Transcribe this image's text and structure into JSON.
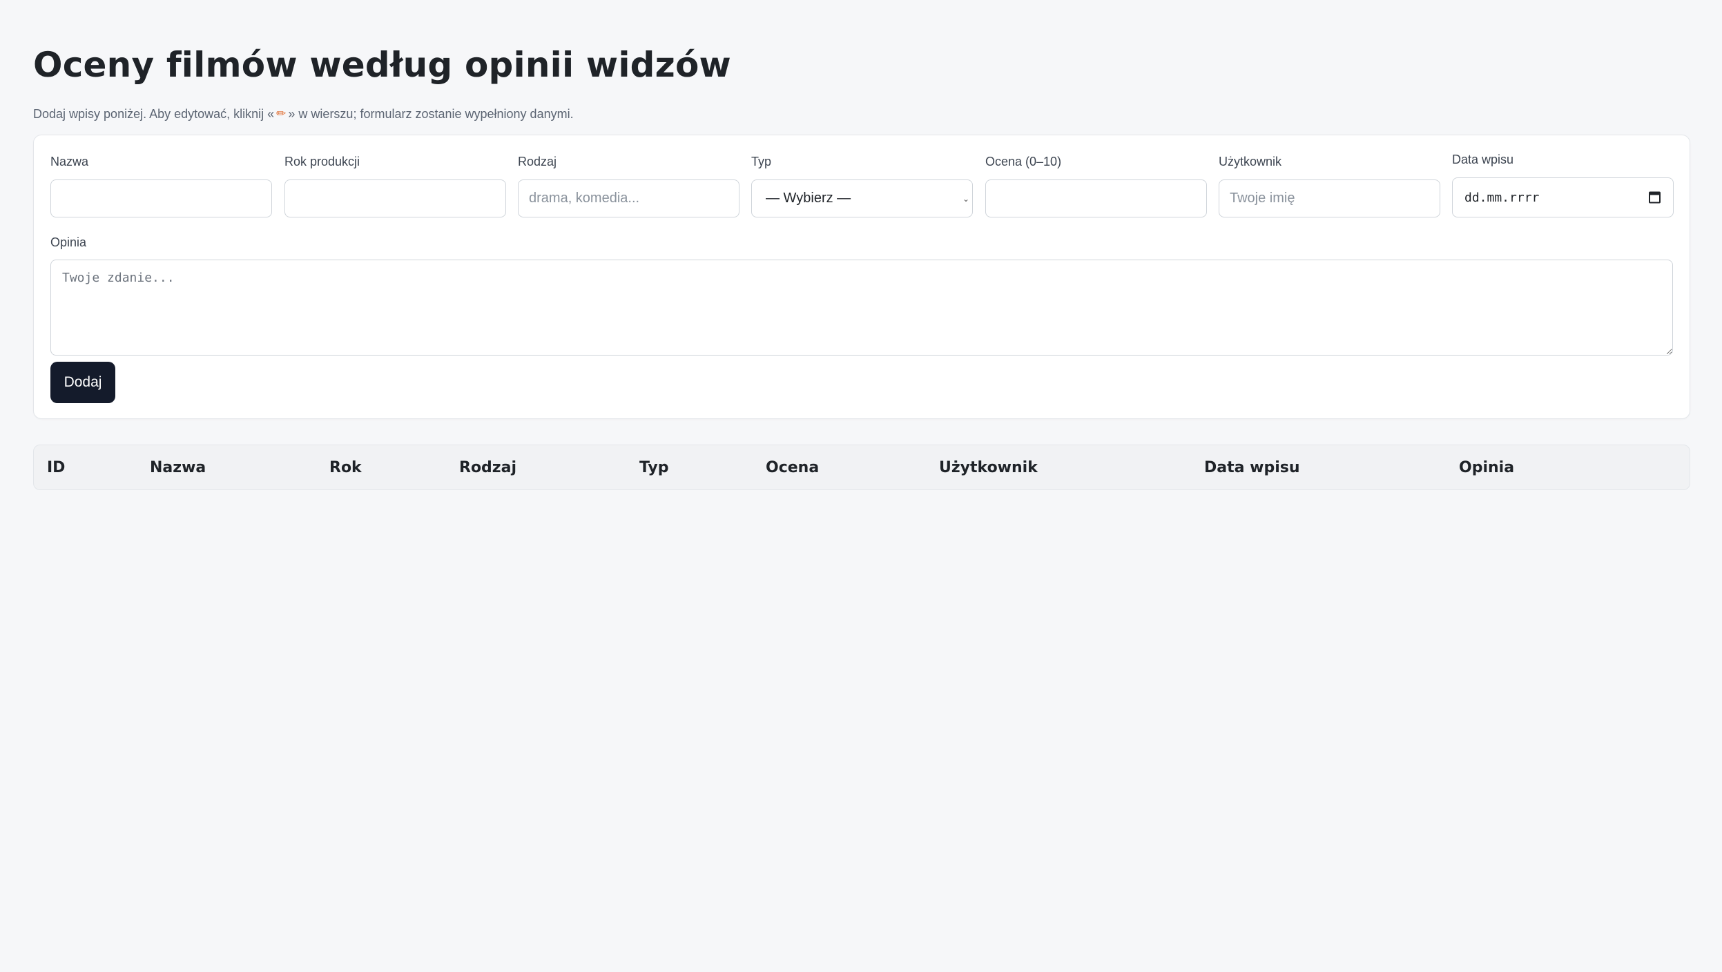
{
  "page": {
    "title": "Oceny filmów według opinii widzów",
    "subtitle_before": "Dodaj wpisy poniżej. Aby edytować, kliknij «",
    "subtitle_icon": "pencil-icon",
    "subtitle_after": "» w wierszu; formularz zostanie wypełniony danymi."
  },
  "form": {
    "fields": {
      "nazwa": {
        "label": "Nazwa",
        "value": "",
        "placeholder": ""
      },
      "rok": {
        "label": "Rok produkcji",
        "value": "",
        "placeholder": ""
      },
      "rodzaj": {
        "label": "Rodzaj",
        "value": "",
        "placeholder": "drama, komedia..."
      },
      "typ": {
        "label": "Typ",
        "selected": "— Wybierz —"
      },
      "ocena": {
        "label": "Ocena (0–10)",
        "value": "",
        "placeholder": ""
      },
      "uzytkownik": {
        "label": "Użytkownik",
        "value": "",
        "placeholder": "Twoje imię"
      },
      "data": {
        "label": "Data wpisu",
        "placeholder": "dd.mm.rrrr"
      }
    },
    "opinia": {
      "label": "Opinia",
      "placeholder": "Twoje zdanie..."
    },
    "submit_label": "Dodaj"
  },
  "table": {
    "columns": [
      "ID",
      "Nazwa",
      "Rok",
      "Rodzaj",
      "Typ",
      "Ocena",
      "Użytkownik",
      "Data wpisu",
      "Opinia"
    ],
    "rows": []
  },
  "colors": {
    "background": "#f6f7f9",
    "button": "#141b2b",
    "pencil": "#e06b2e"
  }
}
